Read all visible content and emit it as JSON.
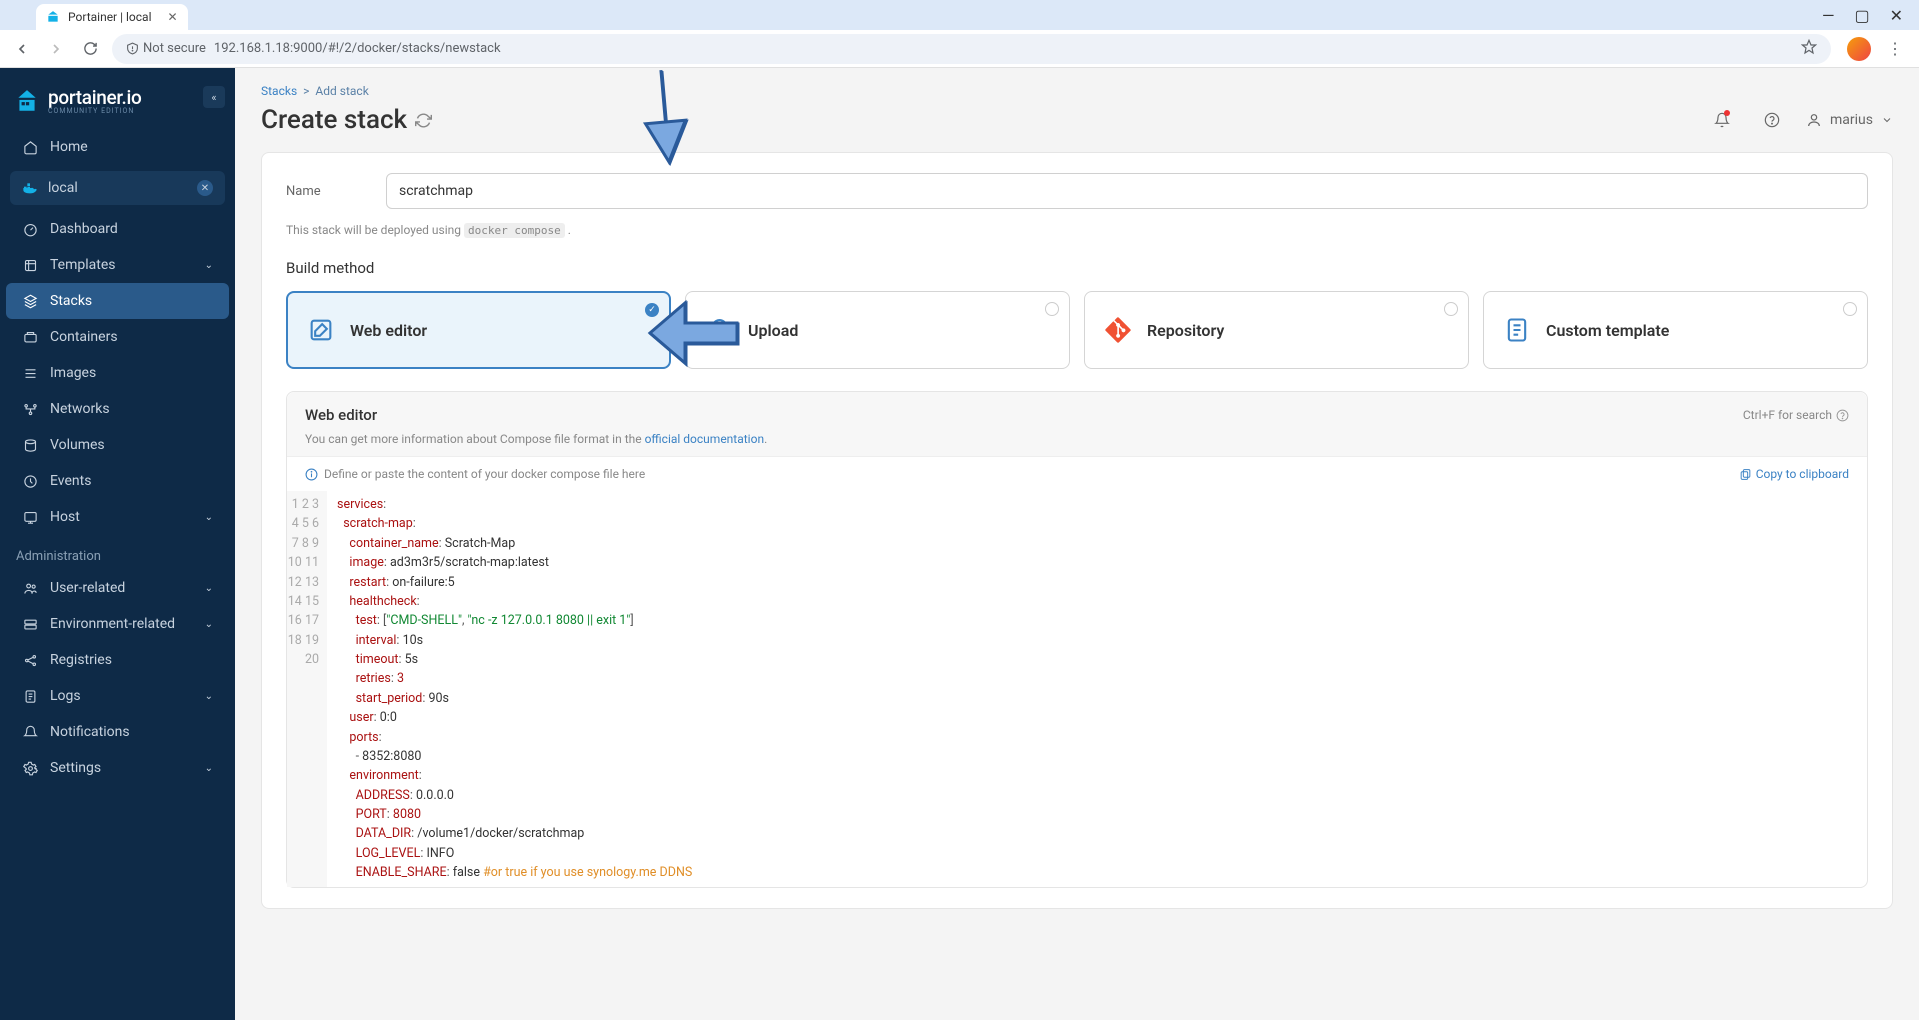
{
  "browser": {
    "tab_title": "Portainer | local",
    "not_secure_label": "Not secure",
    "url": "192.168.1.18:9000/#!/2/docker/stacks/newstack"
  },
  "brand": {
    "name": "portainer.io",
    "edition": "COMMUNITY EDITION"
  },
  "sidebar": {
    "home": "Home",
    "env": "local",
    "items": [
      {
        "label": "Dashboard"
      },
      {
        "label": "Templates",
        "chev": true
      },
      {
        "label": "Stacks",
        "active": true
      },
      {
        "label": "Containers"
      },
      {
        "label": "Images"
      },
      {
        "label": "Networks"
      },
      {
        "label": "Volumes"
      },
      {
        "label": "Events"
      },
      {
        "label": "Host",
        "chev": true
      }
    ],
    "admin_label": "Administration",
    "admin_items": [
      {
        "label": "User-related",
        "chev": true
      },
      {
        "label": "Environment-related",
        "chev": true
      },
      {
        "label": "Registries"
      },
      {
        "label": "Logs",
        "chev": true
      },
      {
        "label": "Notifications"
      },
      {
        "label": "Settings",
        "chev": true
      }
    ]
  },
  "breadcrumb": {
    "root": "Stacks",
    "sep": ">",
    "leaf": "Add stack"
  },
  "page": {
    "title": "Create stack"
  },
  "user": {
    "name": "marius"
  },
  "form": {
    "name_label": "Name",
    "name_value": "scratchmap",
    "deploy_note_pre": "This stack will be deployed using ",
    "deploy_note_cmd": "docker compose",
    "deploy_note_post": " ."
  },
  "build": {
    "section": "Build method",
    "methods": [
      {
        "key": "web",
        "label": "Web editor",
        "selected": true
      },
      {
        "key": "upload",
        "label": "Upload"
      },
      {
        "key": "repo",
        "label": "Repository"
      },
      {
        "key": "template",
        "label": "Custom template"
      }
    ]
  },
  "editor": {
    "title": "Web editor",
    "search_hint": "Ctrl+F for search",
    "desc_pre": "You can get more information about Compose file format in the ",
    "desc_link": "official documentation",
    "desc_post": ".",
    "placeholder": "Define or paste the content of your docker compose file here",
    "copy_label": "Copy to clipboard",
    "lines": [
      [
        [
          "key",
          "services"
        ],
        [
          "p",
          ":"
        ]
      ],
      [
        [
          "sp",
          "  "
        ],
        [
          "key",
          "scratch-map"
        ],
        [
          "p",
          ":"
        ]
      ],
      [
        [
          "sp",
          "    "
        ],
        [
          "key",
          "container_name"
        ],
        [
          "p",
          ": "
        ],
        [
          "txt",
          "Scratch-Map"
        ]
      ],
      [
        [
          "sp",
          "    "
        ],
        [
          "key",
          "image"
        ],
        [
          "p",
          ": "
        ],
        [
          "txt",
          "ad3m3r5/scratch-map:latest"
        ]
      ],
      [
        [
          "sp",
          "    "
        ],
        [
          "key",
          "restart"
        ],
        [
          "p",
          ": "
        ],
        [
          "txt",
          "on-failure:5"
        ]
      ],
      [
        [
          "sp",
          "    "
        ],
        [
          "key",
          "healthcheck"
        ],
        [
          "p",
          ":"
        ]
      ],
      [
        [
          "sp",
          "      "
        ],
        [
          "key",
          "test"
        ],
        [
          "p",
          ": ["
        ],
        [
          "str",
          "\"CMD-SHELL\""
        ],
        [
          "p",
          ", "
        ],
        [
          "str",
          "\"nc -z 127.0.0.1 8080 || exit 1\""
        ],
        [
          "p",
          "]"
        ]
      ],
      [
        [
          "sp",
          "      "
        ],
        [
          "key",
          "interval"
        ],
        [
          "p",
          ": "
        ],
        [
          "txt",
          "10s"
        ]
      ],
      [
        [
          "sp",
          "      "
        ],
        [
          "key",
          "timeout"
        ],
        [
          "p",
          ": "
        ],
        [
          "txt",
          "5s"
        ]
      ],
      [
        [
          "sp",
          "      "
        ],
        [
          "key",
          "retries"
        ],
        [
          "p",
          ": "
        ],
        [
          "num",
          "3"
        ]
      ],
      [
        [
          "sp",
          "      "
        ],
        [
          "key",
          "start_period"
        ],
        [
          "p",
          ": "
        ],
        [
          "txt",
          "90s"
        ]
      ],
      [
        [
          "sp",
          "    "
        ],
        [
          "key",
          "user"
        ],
        [
          "p",
          ": "
        ],
        [
          "txt",
          "0:0"
        ]
      ],
      [
        [
          "sp",
          "    "
        ],
        [
          "key",
          "ports"
        ],
        [
          "p",
          ":"
        ]
      ],
      [
        [
          "sp",
          "      "
        ],
        [
          "p",
          "- "
        ],
        [
          "txt",
          "8352:8080"
        ]
      ],
      [
        [
          "sp",
          "    "
        ],
        [
          "key",
          "environment"
        ],
        [
          "p",
          ":"
        ]
      ],
      [
        [
          "sp",
          "      "
        ],
        [
          "key",
          "ADDRESS"
        ],
        [
          "p",
          ": "
        ],
        [
          "txt",
          "0.0.0.0"
        ]
      ],
      [
        [
          "sp",
          "      "
        ],
        [
          "key",
          "PORT"
        ],
        [
          "p",
          ": "
        ],
        [
          "num",
          "8080"
        ]
      ],
      [
        [
          "sp",
          "      "
        ],
        [
          "key",
          "DATA_DIR"
        ],
        [
          "p",
          ": "
        ],
        [
          "txt",
          "/volume1/docker/scratchmap"
        ]
      ],
      [
        [
          "sp",
          "      "
        ],
        [
          "key",
          "LOG_LEVEL"
        ],
        [
          "p",
          ": "
        ],
        [
          "txt",
          "INFO"
        ]
      ],
      [
        [
          "sp",
          "      "
        ],
        [
          "key",
          "ENABLE_SHARE"
        ],
        [
          "p",
          ": "
        ],
        [
          "txt",
          "false "
        ],
        [
          "comment",
          "#or true if you use synology.me DDNS"
        ]
      ]
    ]
  }
}
